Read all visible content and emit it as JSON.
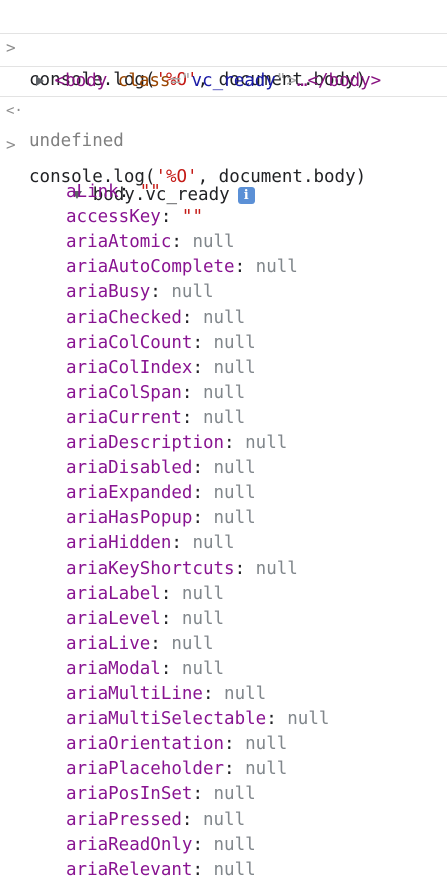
{
  "console": {
    "entries": [
      {
        "type": "input",
        "text_before": "console.log(",
        "str": "'%O'",
        "text_after": ", document.body)"
      },
      {
        "type": "output_element",
        "tag_open": "<body",
        "attr_name": "class",
        "attr_eq": "=\"",
        "attr_value": "vc_ready",
        "attr_close": "\">",
        "ellipsis": "…",
        "tag_close": "</body>"
      },
      {
        "type": "result",
        "text": "undefined"
      },
      {
        "type": "input",
        "text_before": "console.log(",
        "str": "'%O'",
        "text_after": ", document.body)"
      }
    ],
    "object_header": {
      "label": "body.vc_ready",
      "badge": "i"
    },
    "properties": [
      {
        "key": "aLink",
        "value": "\"\"",
        "kind": "string"
      },
      {
        "key": "accessKey",
        "value": "\"\"",
        "kind": "string"
      },
      {
        "key": "ariaAtomic",
        "value": "null",
        "kind": "null"
      },
      {
        "key": "ariaAutoComplete",
        "value": "null",
        "kind": "null"
      },
      {
        "key": "ariaBusy",
        "value": "null",
        "kind": "null"
      },
      {
        "key": "ariaChecked",
        "value": "null",
        "kind": "null"
      },
      {
        "key": "ariaColCount",
        "value": "null",
        "kind": "null"
      },
      {
        "key": "ariaColIndex",
        "value": "null",
        "kind": "null"
      },
      {
        "key": "ariaColSpan",
        "value": "null",
        "kind": "null"
      },
      {
        "key": "ariaCurrent",
        "value": "null",
        "kind": "null"
      },
      {
        "key": "ariaDescription",
        "value": "null",
        "kind": "null"
      },
      {
        "key": "ariaDisabled",
        "value": "null",
        "kind": "null"
      },
      {
        "key": "ariaExpanded",
        "value": "null",
        "kind": "null"
      },
      {
        "key": "ariaHasPopup",
        "value": "null",
        "kind": "null"
      },
      {
        "key": "ariaHidden",
        "value": "null",
        "kind": "null"
      },
      {
        "key": "ariaKeyShortcuts",
        "value": "null",
        "kind": "null"
      },
      {
        "key": "ariaLabel",
        "value": "null",
        "kind": "null"
      },
      {
        "key": "ariaLevel",
        "value": "null",
        "kind": "null"
      },
      {
        "key": "ariaLive",
        "value": "null",
        "kind": "null"
      },
      {
        "key": "ariaModal",
        "value": "null",
        "kind": "null"
      },
      {
        "key": "ariaMultiLine",
        "value": "null",
        "kind": "null"
      },
      {
        "key": "ariaMultiSelectable",
        "value": "null",
        "kind": "null"
      },
      {
        "key": "ariaOrientation",
        "value": "null",
        "kind": "null"
      },
      {
        "key": "ariaPlaceholder",
        "value": "null",
        "kind": "null"
      },
      {
        "key": "ariaPosInSet",
        "value": "null",
        "kind": "null"
      },
      {
        "key": "ariaPressed",
        "value": "null",
        "kind": "null"
      },
      {
        "key": "ariaReadOnly",
        "value": "null",
        "kind": "null"
      },
      {
        "key": "ariaRelevant",
        "value": "null",
        "kind": "null"
      }
    ]
  }
}
